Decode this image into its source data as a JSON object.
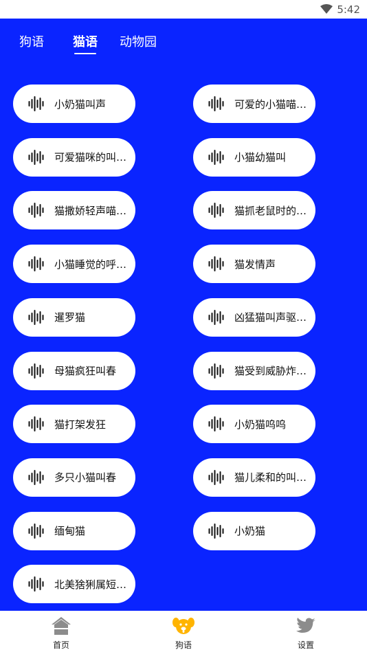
{
  "status_bar": {
    "time": "5:42",
    "wifi_icon": "wifi-icon"
  },
  "tabs": [
    {
      "label": "狗语",
      "active": false
    },
    {
      "label": "猫语",
      "active": true
    },
    {
      "label": "动物园",
      "active": false
    }
  ],
  "sounds": [
    {
      "label": "小奶猫叫声",
      "icon": "sound-wave-icon"
    },
    {
      "label": "可爱的小猫喵…",
      "icon": "sound-wave-icon"
    },
    {
      "label": "可爱猫咪的叫…",
      "icon": "sound-wave-icon"
    },
    {
      "label": "小猫幼猫叫",
      "icon": "sound-wave-icon"
    },
    {
      "label": "猫撒娇轻声喵…",
      "icon": "sound-wave-icon"
    },
    {
      "label": "猫抓老鼠时的…",
      "icon": "sound-wave-icon"
    },
    {
      "label": "小猫睡觉的呼…",
      "icon": "sound-wave-icon"
    },
    {
      "label": "猫发情声",
      "icon": "sound-wave-icon"
    },
    {
      "label": "暹罗猫",
      "icon": "sound-wave-icon"
    },
    {
      "label": "凶猛猫叫声驱…",
      "icon": "sound-wave-icon"
    },
    {
      "label": "母猫疯狂叫春",
      "icon": "sound-wave-icon"
    },
    {
      "label": "猫受到威胁炸…",
      "icon": "sound-wave-icon"
    },
    {
      "label": "猫打架发狂",
      "icon": "sound-wave-icon"
    },
    {
      "label": "小奶猫呜呜",
      "icon": "sound-wave-icon"
    },
    {
      "label": "多只小猫叫春",
      "icon": "sound-wave-icon"
    },
    {
      "label": "猫儿柔和的叫…",
      "icon": "sound-wave-icon"
    },
    {
      "label": "缅甸猫",
      "icon": "sound-wave-icon"
    },
    {
      "label": "小奶猫",
      "icon": "sound-wave-icon"
    },
    {
      "label": "北美猞猁属短…",
      "icon": "sound-wave-icon"
    }
  ],
  "bottom_nav": [
    {
      "label": "首页",
      "icon": "home-icon",
      "active": false
    },
    {
      "label": "狗语",
      "icon": "dog-face-icon",
      "active": true
    },
    {
      "label": "设置",
      "icon": "bird-icon",
      "active": false
    }
  ],
  "colors": {
    "background": "#0a24ff",
    "pill": "#ffffff",
    "nav_active": "#ffb400",
    "nav_inactive": "#8c8c8c"
  }
}
